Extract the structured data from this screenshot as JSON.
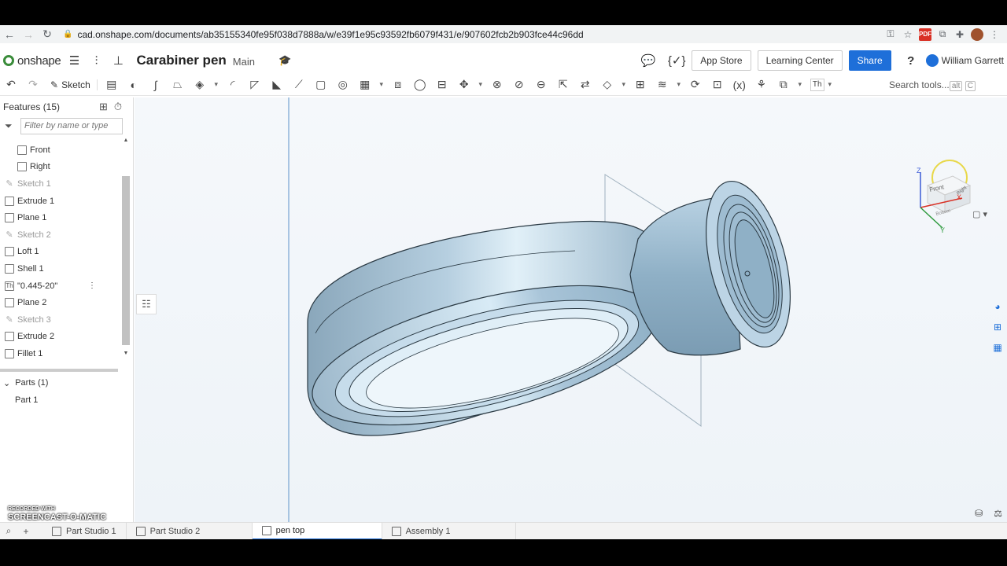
{
  "browser": {
    "url": "cad.onshape.com/documents/ab35155340fe95f038d7888a/w/e39f1e95c93592fb6079f431/e/907602fcb2b903fce44c96dd",
    "ext_pdf": "PDF"
  },
  "app": {
    "logo": "onshape",
    "doc_title": "Carabiner pen",
    "branch": "Main",
    "app_store": "App Store",
    "learning_center": "Learning Center",
    "share": "Share",
    "help": "?",
    "user_name": "William Garrett"
  },
  "toolbar": {
    "sketch_label": "Sketch",
    "variable_label": "(x)",
    "text_label": "Th",
    "search_placeholder": "Search tools...",
    "search_shortcut_1": "alt",
    "search_shortcut_2": "C"
  },
  "features": {
    "header": "Features (15)",
    "filter_placeholder": "Filter by name or type",
    "items": [
      {
        "label": "Front",
        "kind": "plane",
        "indent": true
      },
      {
        "label": "Right",
        "kind": "plane",
        "indent": true
      },
      {
        "label": "Sketch 1",
        "kind": "sketch",
        "dim": true
      },
      {
        "label": "Extrude 1",
        "kind": "extrude"
      },
      {
        "label": "Plane 1",
        "kind": "plane"
      },
      {
        "label": "Sketch 2",
        "kind": "sketch",
        "dim": true
      },
      {
        "label": "Loft 1",
        "kind": "loft"
      },
      {
        "label": "Shell 1",
        "kind": "shell"
      },
      {
        "label": "\"0.445-20\"",
        "kind": "text",
        "text_glyph": "Th"
      },
      {
        "label": "Plane 2",
        "kind": "plane"
      },
      {
        "label": "Sketch 3",
        "kind": "sketch",
        "dim": true
      },
      {
        "label": "Extrude 2",
        "kind": "extrude"
      },
      {
        "label": "Fillet 1",
        "kind": "fillet"
      }
    ],
    "parts_header": "Parts (1)",
    "parts": [
      "Part 1"
    ]
  },
  "viewcube": {
    "axis_z": "Z",
    "axis_x": "X",
    "axis_y": "Y",
    "face_front": "Front",
    "face_right": "Right",
    "face_bottom": "Bottom"
  },
  "tabs": [
    {
      "label": "Part Studio 1",
      "kind": "part-studio",
      "active": false
    },
    {
      "label": "Part Studio 2",
      "kind": "part-studio",
      "active": false
    },
    {
      "label": "pen top",
      "kind": "part-studio",
      "active": true
    },
    {
      "label": "Assembly 1",
      "kind": "assembly",
      "active": false
    }
  ],
  "watermark": {
    "line1": "RECORDED WITH",
    "line2": "SCREENCAST-O-MATIC"
  },
  "colors": {
    "accent": "#1e6fd9",
    "model": "#a9c6da",
    "model_edge": "#2b3a44"
  }
}
